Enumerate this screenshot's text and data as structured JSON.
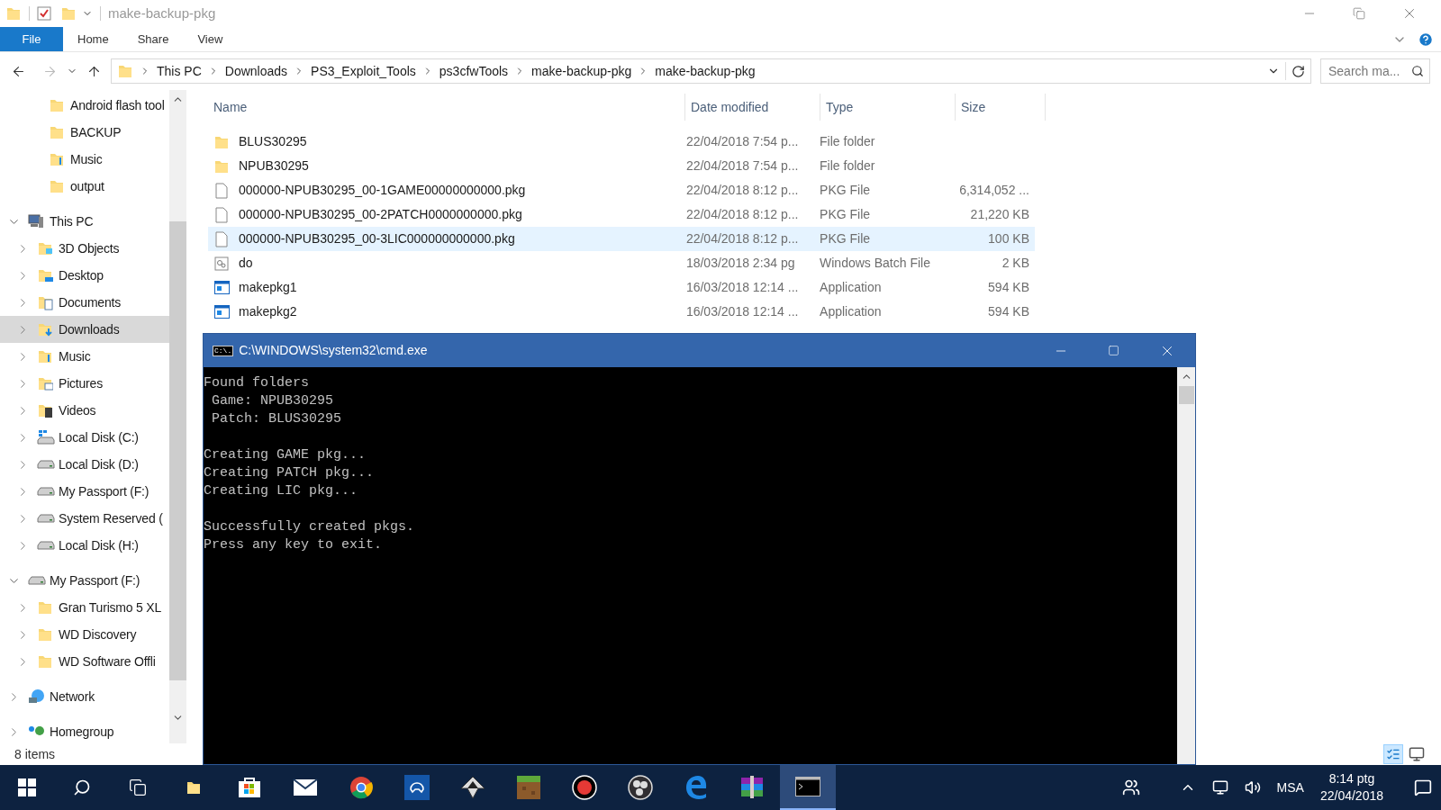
{
  "window": {
    "title": "make-backup-pkg"
  },
  "ribbon": {
    "tabs": [
      {
        "label": "File",
        "kind": "file"
      },
      {
        "label": "Home",
        "kind": "tab"
      },
      {
        "label": "Share",
        "kind": "tab"
      },
      {
        "label": "View",
        "kind": "tab"
      }
    ]
  },
  "address_bar": {
    "path": [
      "This PC",
      "Downloads",
      "PS3_Exploit_Tools",
      "ps3cfwTools",
      "make-backup-pkg",
      "make-backup-pkg"
    ]
  },
  "search": {
    "placeholder": "Search ma..."
  },
  "quick_access": [
    {
      "label": "Android flash tool",
      "kind": "folder",
      "selected": false
    },
    {
      "label": "BACKUP",
      "kind": "folder",
      "selected": false
    },
    {
      "label": "Music",
      "kind": "music",
      "selected": false
    },
    {
      "label": "output",
      "kind": "folder",
      "selected": false
    }
  ],
  "tree": [
    {
      "label": "This PC",
      "kind": "pc",
      "expanded": true,
      "selected": false,
      "children": [
        {
          "label": "3D Objects",
          "kind": "objects",
          "expanded": false,
          "selected": false
        },
        {
          "label": "Desktop",
          "kind": "desktop",
          "expanded": false,
          "selected": false
        },
        {
          "label": "Documents",
          "kind": "documents",
          "expanded": false,
          "selected": false
        },
        {
          "label": "Downloads",
          "kind": "downloads",
          "expanded": false,
          "selected": true
        },
        {
          "label": "Music",
          "kind": "music",
          "expanded": false,
          "selected": false
        },
        {
          "label": "Pictures",
          "kind": "pictures",
          "expanded": false,
          "selected": false
        },
        {
          "label": "Videos",
          "kind": "videos",
          "expanded": false,
          "selected": false
        },
        {
          "label": "Local Disk (C:)",
          "kind": "system-drive",
          "expanded": false,
          "selected": false
        },
        {
          "label": "Local Disk (D:)",
          "kind": "drive",
          "expanded": false,
          "selected": false
        },
        {
          "label": "My Passport (F:)",
          "kind": "drive",
          "expanded": false,
          "selected": false
        },
        {
          "label": "System Reserved (",
          "kind": "drive",
          "expanded": false,
          "selected": false
        },
        {
          "label": "Local Disk (H:)",
          "kind": "drive",
          "expanded": false,
          "selected": false
        }
      ]
    },
    {
      "label": "My Passport (F:)",
      "kind": "drive",
      "expanded": true,
      "selected": false,
      "children": [
        {
          "label": "Gran Turismo 5 XL",
          "kind": "folder",
          "expanded": false,
          "selected": false
        },
        {
          "label": "WD Discovery",
          "kind": "folder",
          "expanded": false,
          "selected": false
        },
        {
          "label": "WD Software Offli",
          "kind": "folder",
          "expanded": false,
          "selected": false
        }
      ]
    },
    {
      "label": "Network",
      "kind": "network",
      "expanded": false,
      "selected": false
    },
    {
      "label": "Homegroup",
      "kind": "homegroup",
      "expanded": false,
      "selected": false
    }
  ],
  "file_list": {
    "columns": [
      "Name",
      "Date modified",
      "Type",
      "Size"
    ],
    "rows": [
      {
        "kind": "folder",
        "name": "BLUS30295",
        "date": "22/04/2018 7:54 p...",
        "type": "File folder",
        "selected": false
      },
      {
        "kind": "folder",
        "name": "NPUB30295",
        "date": "22/04/2018 7:54 p...",
        "type": "File folder",
        "selected": false
      },
      {
        "kind": "file",
        "name": "000000-NPUB30295_00-1GAME00000000000.pkg",
        "date": "22/04/2018 8:12 p...",
        "type": "PKG File",
        "size": "6,314,052 ...",
        "selected": false
      },
      {
        "kind": "file",
        "name": "000000-NPUB30295_00-2PATCH0000000000.pkg",
        "date": "22/04/2018 8:12 p...",
        "type": "PKG File",
        "size": "21,220 KB",
        "selected": false
      },
      {
        "kind": "file",
        "name": "000000-NPUB30295_00-3LIC000000000000.pkg",
        "date": "22/04/2018 8:12 p...",
        "type": "PKG File",
        "size": "100 KB",
        "selected": true
      },
      {
        "kind": "batch",
        "name": "do",
        "date": "18/03/2018 2:34 pg",
        "type": "Windows Batch File",
        "size": "2 KB",
        "selected": false
      },
      {
        "kind": "app",
        "name": "makepkg1",
        "date": "16/03/2018 12:14 ...",
        "type": "Application",
        "size": "594 KB",
        "selected": false
      },
      {
        "kind": "app",
        "name": "makepkg2",
        "date": "16/03/2018 12:14 ...",
        "type": "Application",
        "size": "594 KB",
        "selected": false
      }
    ]
  },
  "status_bar": {
    "item_count": "8 items"
  },
  "console": {
    "title": "C:\\WINDOWS\\system32\\cmd.exe",
    "icon_text": "C:\\.",
    "blocks": [
      [
        "Found folders",
        " Game: NPUB30295",
        " Patch: BLUS30295"
      ],
      [
        "Creating GAME pkg...",
        "Creating PATCH pkg...",
        "Creating LIC pkg..."
      ],
      [
        "Successfully created pkgs.",
        "Press any key to exit."
      ]
    ]
  },
  "taskbar": {
    "apps": [
      {
        "kind": "explorer",
        "active": false
      },
      {
        "kind": "store",
        "active": false
      },
      {
        "kind": "mail",
        "active": false
      },
      {
        "kind": "chrome",
        "active": false
      },
      {
        "kind": "ps4",
        "active": false
      },
      {
        "kind": "inkscape",
        "active": false
      },
      {
        "kind": "minecraft",
        "active": false
      },
      {
        "kind": "record",
        "active": false
      },
      {
        "kind": "obs",
        "active": false
      },
      {
        "kind": "edge",
        "active": false
      },
      {
        "kind": "winrar",
        "active": false
      },
      {
        "kind": "console",
        "active": true
      }
    ],
    "language": "MSA",
    "time": "8:14 ptg",
    "date": "22/04/2018"
  }
}
